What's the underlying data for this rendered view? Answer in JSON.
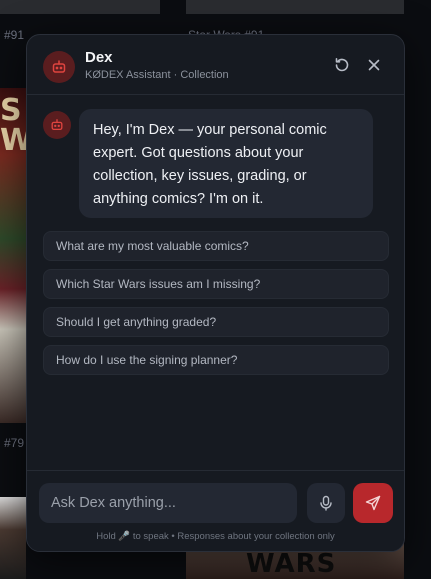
{
  "background": {
    "labels": [
      "#91",
      "Star Wars #91",
      "#79"
    ],
    "cover_text_left": "S W",
    "cover_text_bottom": "WARS"
  },
  "chat": {
    "header": {
      "title": "Dex",
      "subtitle": "KØDEX Assistant · Collection",
      "avatar_icon": "robot-icon",
      "refresh_icon": "refresh-icon",
      "close_icon": "close-icon"
    },
    "greeting": "Hey, I'm Dex — your personal comic expert. Got questions about your collection, key issues, grading, or anything comics? I'm on it.",
    "suggestions": [
      "What are my most valuable comics?",
      "Which Star Wars issues am I missing?",
      "Should I get anything graded?",
      "How do I use the signing planner?"
    ],
    "input": {
      "placeholder": "Ask Dex anything...",
      "value": ""
    },
    "hint": "Hold 🎤 to speak • Responses about your collection only",
    "colors": {
      "accent": "#b8282c",
      "panel": "#161a21",
      "bubble": "#232833",
      "avatar_bg": "#5a1d1f"
    }
  }
}
